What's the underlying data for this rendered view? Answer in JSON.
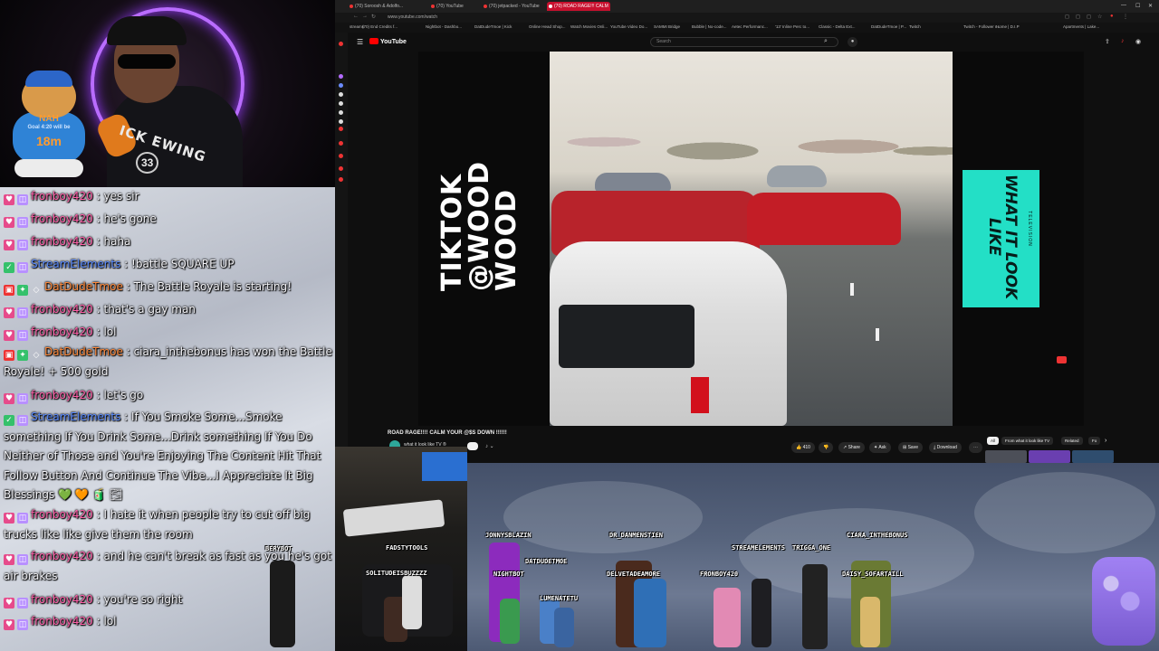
{
  "webcam": {
    "shirt_text": "ICK EWING",
    "shirt_number": "33",
    "bear_label": "NAH",
    "bear_sub": "Goal 4:20 will be",
    "bear_timer": "18m"
  },
  "chat": {
    "messages": [
      {
        "user": "fronboy420",
        "text": " : yes sir",
        "badges": [
          "heart",
          "sub"
        ],
        "color": "pink"
      },
      {
        "user": "fronboy420",
        "text": " : he's gone",
        "badges": [
          "heart",
          "sub"
        ],
        "color": "pink"
      },
      {
        "user": "fronboy420",
        "text": " : haha",
        "badges": [
          "heart",
          "sub"
        ],
        "color": "pink"
      },
      {
        "user": "StreamElements",
        "text": " : !battle SQUARE UP",
        "badges": [
          "check",
          "sub"
        ],
        "color": "blue"
      },
      {
        "user": "DatDudeTmoe",
        "text": " : The Battle Royale is starting!",
        "badges": [
          "red",
          "mod",
          "prime"
        ],
        "color": "orange"
      },
      {
        "user": "fronboy420",
        "text": " : that's a gay man",
        "badges": [
          "heart",
          "sub"
        ],
        "color": "pink"
      },
      {
        "user": "fronboy420",
        "text": " : lol",
        "badges": [
          "heart",
          "sub"
        ],
        "color": "pink"
      },
      {
        "user": "DatDudeTmoe",
        "text": " : ciara_inthebonus has won the Battle Royale! + 500 gold",
        "badges": [
          "red",
          "mod",
          "prime"
        ],
        "color": "orange"
      },
      {
        "user": "fronboy420",
        "text": " : let's go",
        "badges": [
          "heart",
          "sub"
        ],
        "color": "pink"
      },
      {
        "user": "StreamElements",
        "text": " : If You Smoke Some...Smoke something If You Drink Some...Drink something If You Do Neither of Those and You're Enjoying The Content Hit That Follow Button And Continue The Vibe...I Appreciate It Big Blessings 💚 🧡 🧃 🌫",
        "badges": [
          "check",
          "sub"
        ],
        "color": "blue"
      },
      {
        "user": "fronboy420",
        "text": " : I hate it when people try to cut off big trucks like like give them the room",
        "badges": [
          "heart",
          "sub"
        ],
        "color": "pink"
      },
      {
        "user": "fronboy420",
        "text": " : and he can't break as fast as you he's got air brakes",
        "badges": [
          "heart",
          "sub"
        ],
        "color": "pink"
      },
      {
        "user": "fronboy420",
        "text": " : you're so right",
        "badges": [
          "heart",
          "sub"
        ],
        "color": "pink"
      },
      {
        "user": "fronboy420",
        "text": " : lol",
        "badges": [
          "heart",
          "sub"
        ],
        "color": "pink"
      }
    ]
  },
  "browser": {
    "tabs": [
      {
        "label": "(70) Soroosh & Adolfo...",
        "active": false
      },
      {
        "label": "(70) YouTube",
        "active": false
      },
      {
        "label": "(70) jetpacked - YouTube",
        "active": false
      },
      {
        "label": "(70) ROAD RAGE!!! CALM",
        "active": true
      }
    ],
    "url": "www.youtube.com/watch",
    "bookmarks": [
      "streams",
      "(70) End Credits f...",
      "Nightbot - Dashbo...",
      "DatDudeTmoe | Kick",
      "Online Head Shop...",
      "Watch Movies Onli...",
      "YouTube Video Do...",
      "SAMMI Bridge",
      "Bubble | No-code...",
      "Aetec Performanc...",
      "'13' Inline Perc to...",
      "Classic - Delta Ext...",
      "DatDudeTmoe | P...",
      "Twitch",
      "Twitch - Follower r...",
      "Home | D.I.P",
      "Apartments | Lake..."
    ]
  },
  "youtube": {
    "logo": "YouTube",
    "search_placeholder": "Search",
    "video_title": "ROAD RAGE!!!! CALM YOUR @$S DOWN !!!!!!",
    "channel_name": "what it look like TV ®",
    "likes": "410",
    "share": "Share",
    "ask": "Ask",
    "save": "Save",
    "download": "Download",
    "chips": [
      "All",
      "From what it look like TV",
      "Related",
      "Fo"
    ]
  },
  "video_overlay": {
    "left_text": "TIKTOK @WOOD WOOD",
    "right_text": "WHAT IT LOOK LIKE",
    "right_sub": "TELEVISION"
  },
  "overlay": {
    "sprites": [
      {
        "name": "BERYBOT"
      },
      {
        "name": "FADSTYTOOLS"
      },
      {
        "name": "SOLITUDEISBUZZZZ"
      },
      {
        "name": "JONNYSBLAZIN"
      },
      {
        "name": "DATDUDETMOE"
      },
      {
        "name": "NIGHTBOT"
      },
      {
        "name": "LUMENATETU"
      },
      {
        "name": "DR_DANMENSTIEN"
      },
      {
        "name": "DELVETADEAMORE"
      },
      {
        "name": "FRONBOY420"
      },
      {
        "name": "STREAMELEMENTS"
      },
      {
        "name": "TRIGGA_ONE"
      },
      {
        "name": "CIARA_INTHEBONUS"
      },
      {
        "name": "DAISY_SOFARTAILL"
      }
    ]
  },
  "colors": {
    "neon": "#b96cff",
    "teal_box": "#23dfc6",
    "youtube_red": "#ff0000",
    "chat_pink_user": "#ff5fa8",
    "chat_blue_user": "#5b8cff",
    "chat_orange_user": "#ff8a3c"
  }
}
